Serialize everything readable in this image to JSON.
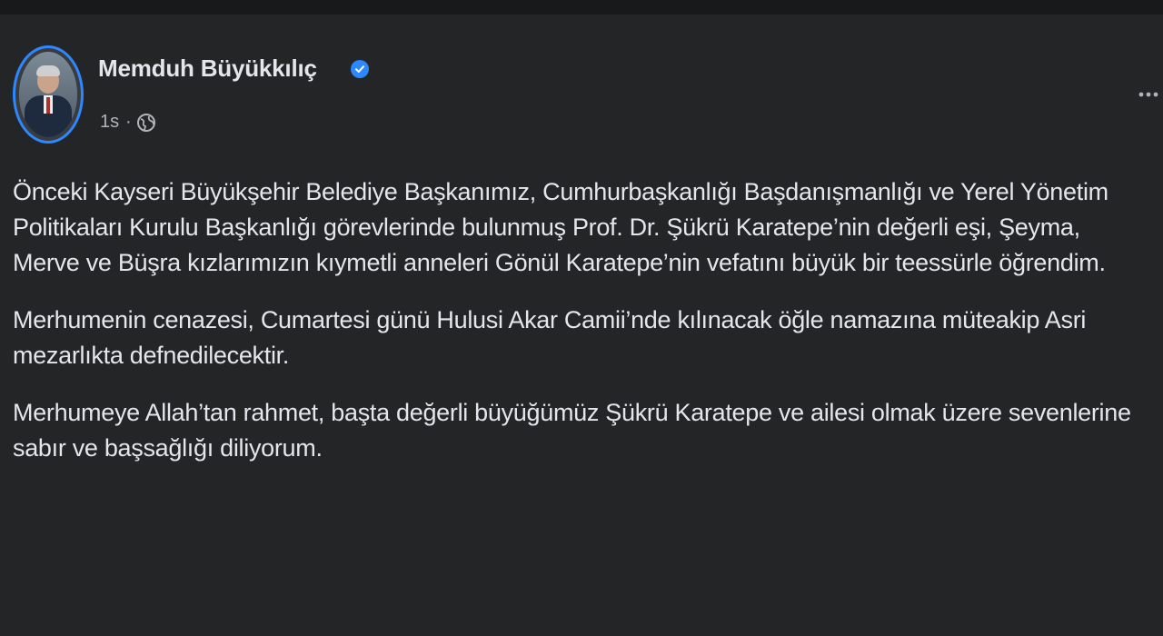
{
  "post": {
    "author": "Memduh Büyükkılıç",
    "verified": true,
    "time": "1s",
    "separator": "·",
    "privacy_icon": "globe-icon",
    "more_icon": "more-options-icon",
    "paragraphs": [
      "Önceki Kayseri Büyükşehir Belediye Başkanımız, Cumhurbaşkanlığı Başdanışmanlığı ve Yerel Yönetim Politikaları Kurulu Başkanlığı görevlerinde bulunmuş Prof. Dr. Şükrü Karatepe’nin değerli eşi, Şeyma, Merve ve Büşra kızlarımızın kıymetli anneleri Gönül Karatepe’nin vefatını büyük bir teessürle öğrendim.",
      "Merhumenin cenazesi, Cumartesi günü Hulusi Akar Camii’nde kılınacak öğle namazına müteakip Asri mezarlıkta defnedilecektir.",
      "Merhumeye Allah’tan rahmet, başta değerli büyüğümüz Şükrü Karatepe ve ailesi olmak üzere sevenlerine sabır ve başsağlığı diliyorum."
    ]
  },
  "colors": {
    "background": "#18191a",
    "card": "#242526",
    "primary_text": "#e4e6eb",
    "secondary_text": "#b0b3b8",
    "accent": "#2d88ff"
  }
}
